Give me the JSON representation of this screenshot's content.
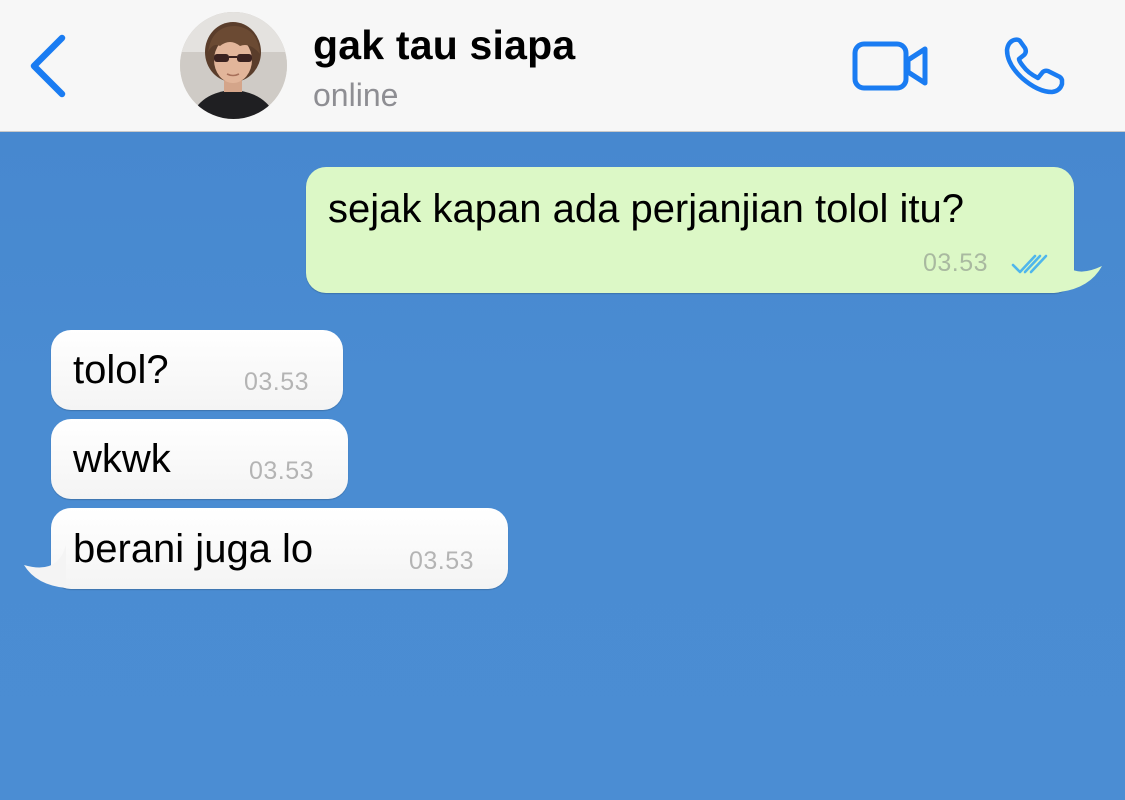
{
  "header": {
    "contact_name": "gak tau siapa",
    "status": "online",
    "back_icon": "chevron-left-icon",
    "video_icon": "video-camera-icon",
    "call_icon": "phone-icon",
    "accent_color": "#1a7cf2"
  },
  "messages": [
    {
      "direction": "outgoing",
      "text": "sejak kapan ada perjanjian tolol itu?",
      "time": "03.53",
      "status": "read",
      "status_icon": "double-check-icon"
    },
    {
      "direction": "incoming",
      "text": "tolol?",
      "time": "03.53"
    },
    {
      "direction": "incoming",
      "text": "wkwk",
      "time": "03.53"
    },
    {
      "direction": "incoming",
      "text": "berani juga lo",
      "time": "03.53"
    }
  ],
  "colors": {
    "chat_background": "#4a8bd0",
    "outgoing_bubble": "#dcf8c6",
    "incoming_bubble": "#ffffff",
    "read_ticks": "#4fb6ec"
  }
}
